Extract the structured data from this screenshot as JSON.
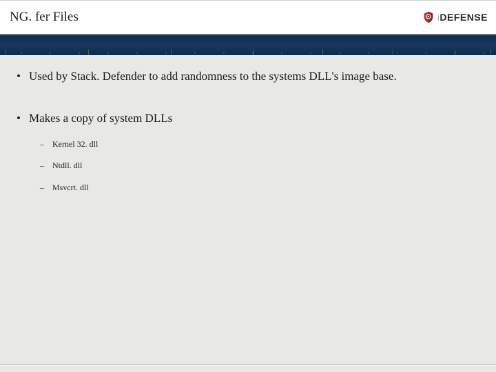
{
  "title": "NG. fer Files",
  "logo": {
    "prefix": "i",
    "main": "DEFENSE"
  },
  "bullets": [
    {
      "text": "Used by Stack. Defender to add randomness to the systems DLL's image base.",
      "sub": []
    },
    {
      "text": "Makes a copy of system DLLs",
      "sub": [
        "Kernel 32. dll",
        "Ntdll. dll",
        "Msvcrt. dll"
      ]
    }
  ]
}
